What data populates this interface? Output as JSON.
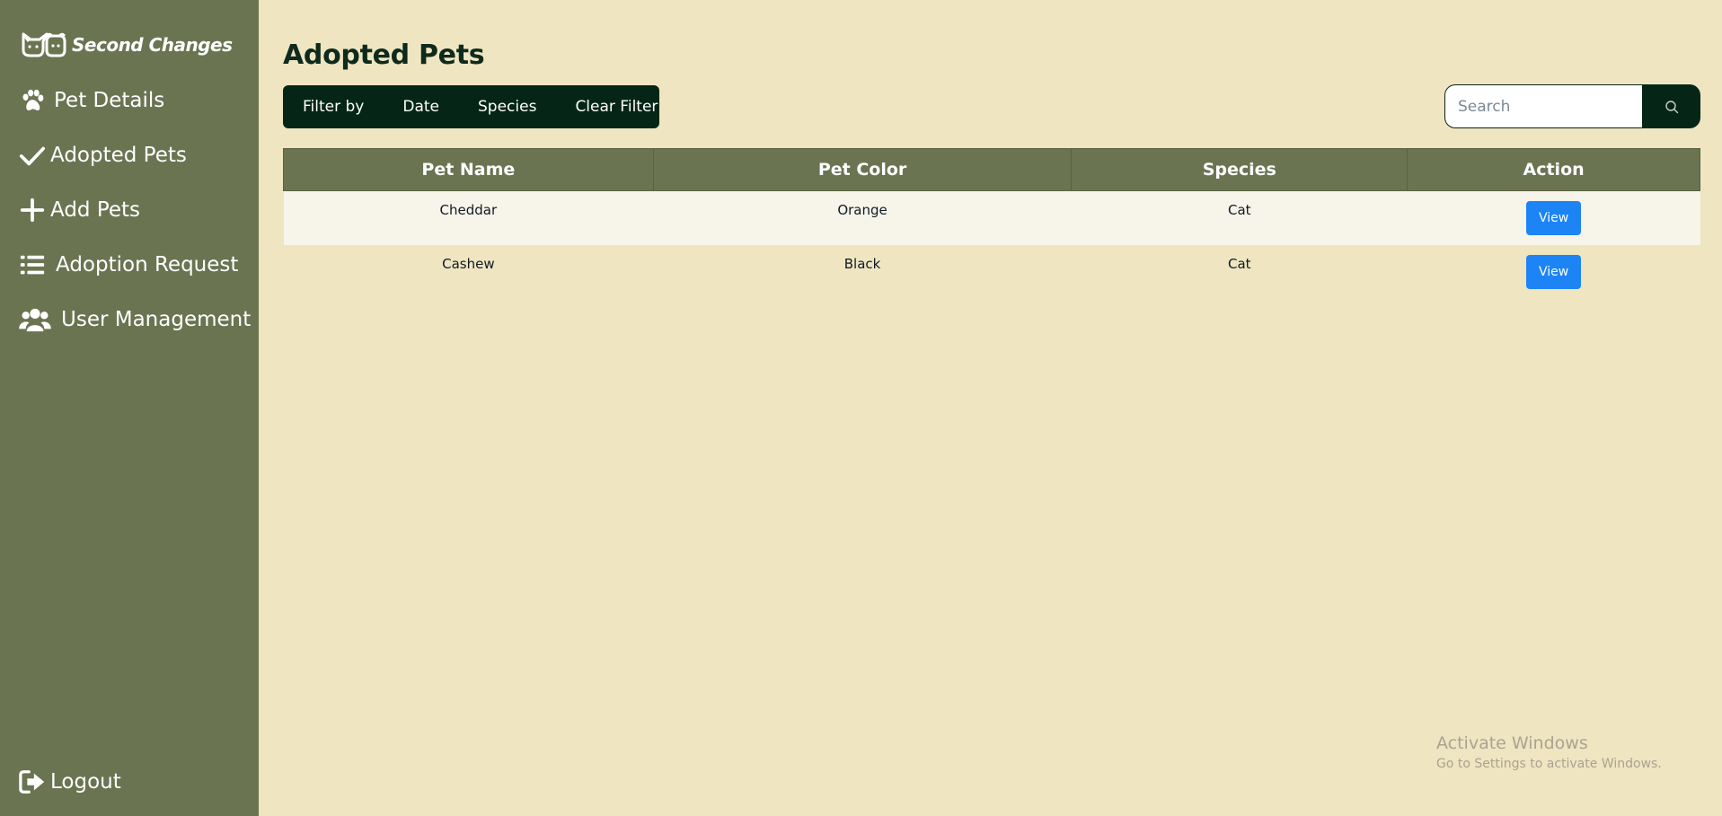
{
  "brand": {
    "name": "Second Changes"
  },
  "sidebar": {
    "items": [
      {
        "label": "Pet Details",
        "icon": "paw-icon"
      },
      {
        "label": "Adopted Pets",
        "icon": "check-icon"
      },
      {
        "label": "Add Pets",
        "icon": "plus-icon"
      },
      {
        "label": "Adoption Request",
        "icon": "list-icon"
      },
      {
        "label": "User Management",
        "icon": "users-icon"
      }
    ],
    "logout": {
      "label": "Logout",
      "icon": "logout-icon"
    }
  },
  "page": {
    "title": "Adopted Pets"
  },
  "filter": {
    "label": "Filter by",
    "date": "Date",
    "species": "Species",
    "clear": "Clear Filter"
  },
  "search": {
    "placeholder": "Search",
    "value": ""
  },
  "table": {
    "headers": [
      "Pet Name",
      "Pet Color",
      "Species",
      "Action"
    ],
    "rows": [
      {
        "name": "Cheddar",
        "color": "Orange",
        "species": "Cat",
        "action": "View"
      },
      {
        "name": "Cashew",
        "color": "Black",
        "species": "Cat",
        "action": "View"
      }
    ]
  },
  "watermark": {
    "title": "Activate Windows",
    "subtitle": "Go to Settings to activate Windows."
  },
  "colors": {
    "sidebar": "#6a7451",
    "background": "#efe5c1",
    "dark": "#052617",
    "accent": "#1d84f6"
  }
}
